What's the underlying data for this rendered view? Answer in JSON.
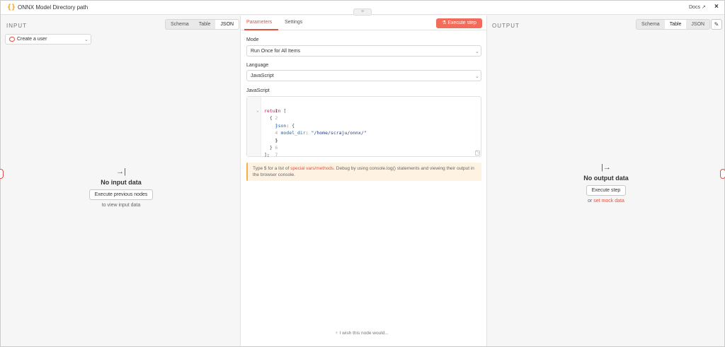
{
  "header": {
    "node_icon": "{}",
    "title": "ONNX Model Directory path",
    "docs_label": "Docs",
    "docs_icon": "external-link-icon",
    "close_icon": "×",
    "handle_icon": "≡"
  },
  "input_panel": {
    "label": "INPUT",
    "view_tabs": [
      "Schema",
      "Table",
      "JSON"
    ],
    "active_tab": "JSON",
    "node_select": "Create a user",
    "empty_icon": "→|",
    "empty_title": "No input data",
    "empty_button": "Execute previous nodes",
    "empty_sub": "to view input data"
  },
  "params_panel": {
    "tabs": [
      "Parameters",
      "Settings"
    ],
    "active_tab": "Parameters",
    "execute_button": "Execute step",
    "execute_icon": "⚗",
    "mode_label": "Mode",
    "mode_value": "Run Once for All Items",
    "language_label": "Language",
    "language_value": "JavaScript",
    "code_label": "JavaScript",
    "code_lines": [
      "return [",
      "  {",
      "    json: {",
      "      model_dir: \"/home/scraju/onnx/\"",
      "    }",
      "  }",
      "];"
    ],
    "hint_before": "Type $ for a list of ",
    "hint_link": "special vars/methods",
    "hint_after": ". Debug by using console.log() statements and viewing their output in the browser console.",
    "wish_text": "I wish this node would..."
  },
  "output_panel": {
    "label": "OUTPUT",
    "view_tabs": [
      "Schema",
      "Table",
      "JSON"
    ],
    "active_tab": "Table",
    "edit_icon": "✎",
    "empty_icon": "|→",
    "empty_title": "No output data",
    "empty_button": "Execute step",
    "empty_or": "or ",
    "empty_link": "set mock data"
  },
  "colors": {
    "accent": "#e5513f",
    "button_fill": "#f26b5b",
    "node_icon": "#f59e0b",
    "hint_bg": "#fef3e2"
  }
}
